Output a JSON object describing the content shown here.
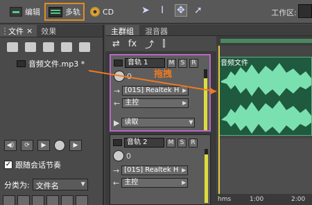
{
  "toolbar": {
    "edit_label": "编辑",
    "multitrack_label": "多轨",
    "cd_label": "CD",
    "workspace_label": "工作区:"
  },
  "files_panel": {
    "tab_files": "文件",
    "tab_close": "×",
    "tab_effects": "效果",
    "file_name": "音频文件.mp3 *",
    "follow_label": "跟随会话节奏",
    "follow_checked": "✓",
    "sort_label": "分类为:",
    "sort_value": "文件名"
  },
  "main_tabs": {
    "main_group": "主群组",
    "mixer": "混音器"
  },
  "tracks": [
    {
      "name": "音轨 1",
      "m": "M",
      "s": "S",
      "r": "R",
      "volume": "0",
      "input": "[01S] Realtek H",
      "output": "主控",
      "automation": "读取",
      "meter_level": 0.85
    },
    {
      "name": "音轨 2",
      "m": "M",
      "s": "S",
      "r": "R",
      "volume": "0",
      "input": "[01S] Realtek H",
      "output": "主控",
      "meter_level": 0.9
    }
  ],
  "timeline": {
    "clip_name": "音频文件",
    "tick_hms": "hms",
    "tick_1": "1:00",
    "tick_2": "2:00"
  },
  "annotation": {
    "drag_text": "拖拽"
  },
  "colors": {
    "accent_orange": "#e58a20",
    "track_select": "#b868c8",
    "waveform": "#7be0b0",
    "playhead": "#e8d040"
  }
}
